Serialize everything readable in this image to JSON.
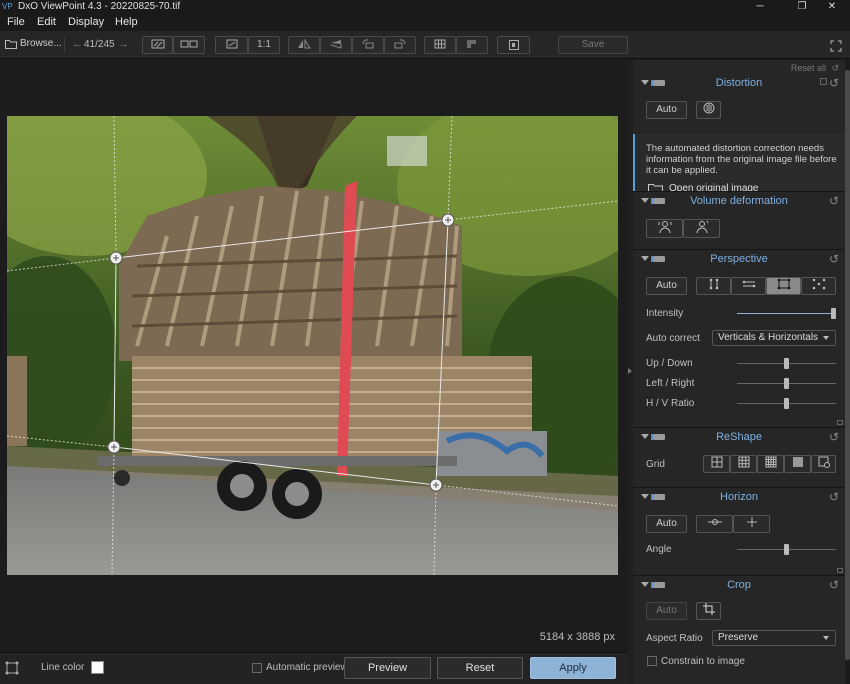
{
  "window": {
    "title": "DxO ViewPoint 4.3 - 20220825-70.tif",
    "app_icon": "VP",
    "minimize": "─",
    "maximize": "❐",
    "close": "✕"
  },
  "menu": [
    "File",
    "Edit",
    "Display",
    "Help"
  ],
  "toolbar": {
    "browse_label": "Browse...",
    "counter": "41/245",
    "one_to_one": "1:1",
    "save_label": "Save"
  },
  "viewer": {
    "image_size": "5184 x 3888 px"
  },
  "bottom": {
    "line_color_label": "Line color",
    "line_color": "#ffffff",
    "automatic_preview": "Automatic preview",
    "preview": "Preview",
    "reset": "Reset",
    "apply": "Apply"
  },
  "panel": {
    "reset_all": "Reset all",
    "distortion": {
      "title": "Distortion",
      "auto": "Auto",
      "info": "The automated distortion correction needs information from the original image file before it can be applied.",
      "open_link": "Open original image"
    },
    "volume": {
      "title": "Volume deformation"
    },
    "perspective": {
      "title": "Perspective",
      "auto": "Auto",
      "intensity_label": "Intensity",
      "intensity": 1.0,
      "auto_correct_label": "Auto correct",
      "auto_correct_value": "Verticals & Horizontals",
      "up_down_label": "Up / Down",
      "up_down": 0.5,
      "left_right_label": "Left / Right",
      "left_right": 0.5,
      "hv_ratio_label": "H / V Ratio",
      "hv_ratio": 0.5
    },
    "reshape": {
      "title": "ReShape",
      "grid_label": "Grid"
    },
    "horizon": {
      "title": "Horizon",
      "auto": "Auto",
      "angle_label": "Angle",
      "angle": 0.5
    },
    "crop": {
      "title": "Crop",
      "auto": "Auto",
      "aspect_label": "Aspect Ratio",
      "aspect_value": "Preserve",
      "constrain_label": "Constrain to image"
    }
  }
}
